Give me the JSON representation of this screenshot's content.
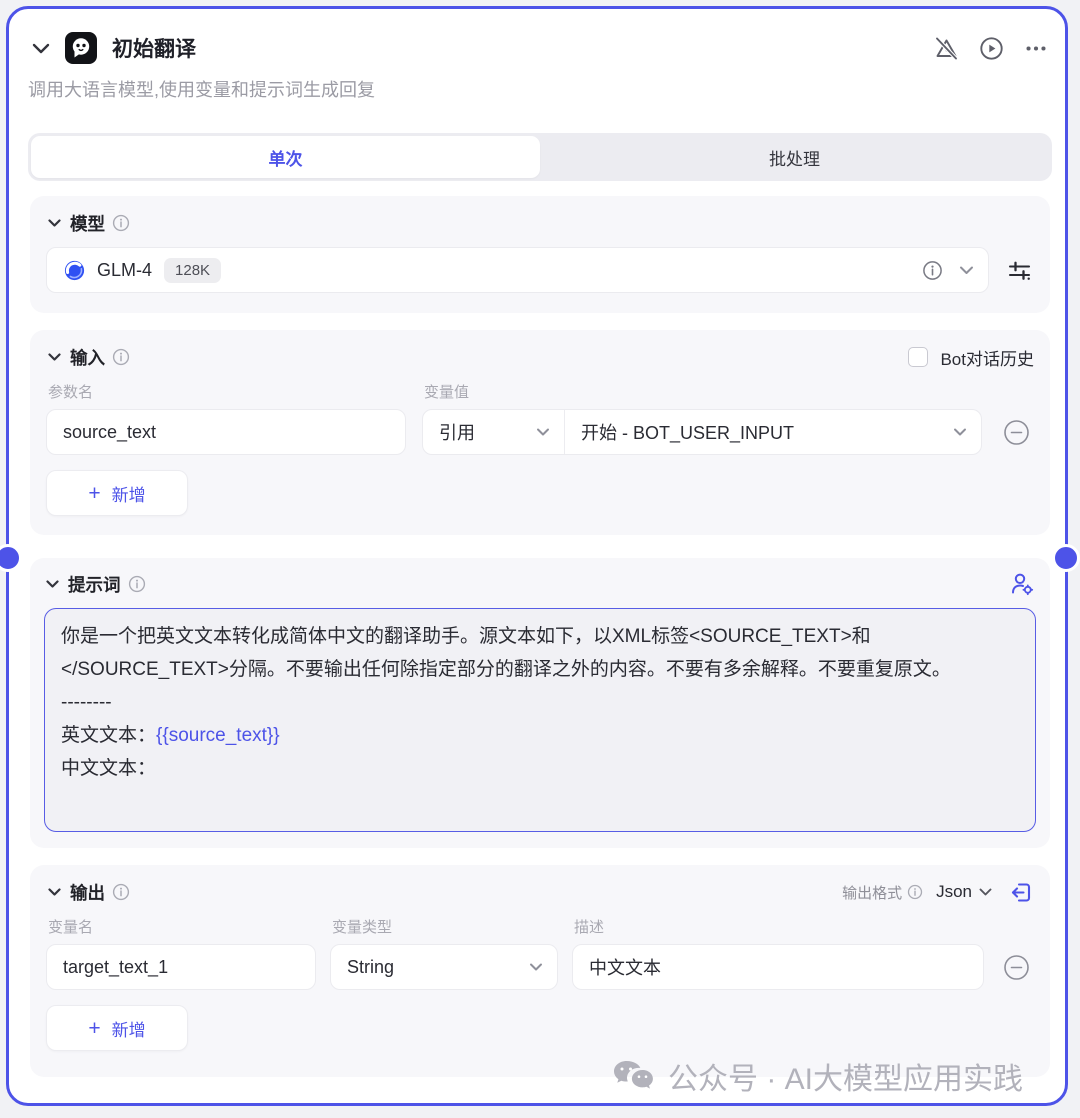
{
  "accent_color": "#4d53e8",
  "header": {
    "title": "初始翻译",
    "subtitle": "调用大语言模型,使用变量和提示词生成回复"
  },
  "tabs": {
    "single": "单次",
    "batch": "批处理"
  },
  "model": {
    "label": "模型",
    "name": "GLM-4",
    "context_badge": "128K"
  },
  "input": {
    "label": "输入",
    "history_label": "Bot对话历史",
    "col_param": "参数名",
    "col_value": "变量值",
    "rows": [
      {
        "param": "source_text",
        "mode": "引用",
        "ref": "开始 - BOT_USER_INPUT"
      }
    ],
    "add_label": "新增",
    "add_plus": "+"
  },
  "prompt": {
    "label": "提示词",
    "text_before": "你是一个把英文文本转化成简体中文的翻译助手。源文本如下，以XML标签<SOURCE_TEXT>和</SOURCE_TEXT>分隔。不要输出任何除指定部分的翻译之外的内容。不要有多余解释。不要重复原文。\n--------\n英文文本：",
    "variable": "{{source_text}}",
    "text_after": "\n中文文本："
  },
  "output": {
    "label": "输出",
    "format_label": "输出格式",
    "format_value": "Json",
    "col_name": "变量名",
    "col_type": "变量类型",
    "col_desc": "描述",
    "rows": [
      {
        "name": "target_text_1",
        "type": "String",
        "desc": "中文文本"
      }
    ],
    "add_label": "新增",
    "add_plus": "+"
  },
  "watermark": "公众号 · AI大模型应用实践",
  "icons": {
    "header_left": [
      "collapse-chevron-icon",
      "bot-avatar-icon"
    ],
    "header_right": [
      "warning-off-icon",
      "run-play-icon",
      "more-ellipsis-icon"
    ],
    "misc": [
      "info-icon",
      "chevron-down-icon",
      "minus-circle-icon",
      "tune-sliders-icon",
      "persona-settings-icon",
      "import-bracket-icon",
      "wechat-icon",
      "glm-logo-icon"
    ]
  }
}
